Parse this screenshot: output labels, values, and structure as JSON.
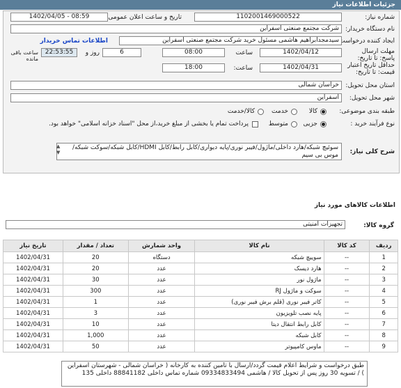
{
  "page_title": "جزئیات اطلاعات نیاز",
  "form": {
    "need_number_label": "شماره نیاز:",
    "need_number": "1102001469000522",
    "announce_label": "تاریخ و ساعت اعلان عمومی:",
    "announce_value": "1402/04/05 - 08:59",
    "buyer_label": "نام دستگاه خریدار:",
    "buyer_value": "شرکت مجتمع صنعتی اسفراین",
    "creator_label": "ایجاد کننده درخواست:",
    "creator_value": "سیدمجدابراهیم هاشمی مسئول خرید شرکت مجتمع صنعتی اسفراین",
    "contact_link": "اطلاعات تماس خریدار",
    "deadline_label": "مهلت ارسال پاسخ: تا تاریخ:",
    "deadline_date": "1402/04/12",
    "time_label": "ساعت",
    "deadline_time": "08:00",
    "days_value": "6",
    "days_label": "روز و",
    "remaining_time": "22:53:55",
    "remaining_label": "ساعت باقی مانده",
    "validity_label": "حداقل تاریخ اعتبار قیمت: تا تاریخ:",
    "validity_date": "1402/04/31",
    "validity_time_label": "ساعت:",
    "validity_time": "18:00",
    "province_label": "استان محل تحویل:",
    "province_value": "خراسان شمالی",
    "city_label": "شهر محل تحویل:",
    "city_value": "اسفراین",
    "category_label": "طبقه بندی موضوعی:",
    "category_options": [
      "کالا",
      "خدمت",
      "کالا/خدمت"
    ],
    "category_selected": 0,
    "process_label": "نوع فرآیند خرید :",
    "process_options": [
      "جزیی",
      "متوسط"
    ],
    "process_selected": 0,
    "payment_note": "پرداخت تمام یا بخشی از مبلغ خرید،از محل \"اسناد خزانه اسلامی\" خواهد بود."
  },
  "summary": {
    "label": "شرح کلی نیاز:",
    "text": "سوئیچ شبکه/هارد داخلی/ماژول/فیبر نوری/پایه دیواری/کابل رابط/کابل HDMI/کابل شبکه/سوکت شبکه/موس بی سیم"
  },
  "goods_section": "اطلاعات کالاهای مورد نیاز",
  "group_label": "گروه کالا:",
  "group_value": "تجهیزات امنیتی",
  "table": {
    "headers": [
      "ردیف",
      "کد کالا",
      "نام کالا",
      "واحد شمارش",
      "تعداد / مقدار",
      "تاریخ نیاز"
    ],
    "rows": [
      [
        "1",
        "--",
        "سوییچ شبکه",
        "دستگاه",
        "20",
        "1402/04/31"
      ],
      [
        "2",
        "--",
        "هارد دیسک",
        "عدد",
        "20",
        "1402/04/31"
      ],
      [
        "3",
        "--",
        "ماژول نور",
        "عدد",
        "30",
        "1402/04/31"
      ],
      [
        "4",
        "--",
        "سوکت و ماژول RJ",
        "عدد",
        "300",
        "1402/04/31"
      ],
      [
        "5",
        "--",
        "کاتر فیبر نوری (قلم برش فیبر نوری)",
        "عدد",
        "1",
        "1402/04/31"
      ],
      [
        "6",
        "--",
        "پایه نصب تلویزیون",
        "عدد",
        "3",
        "1402/04/31"
      ],
      [
        "7",
        "--",
        "کابل رابط انتقال دیتا",
        "عدد",
        "10",
        "1402/04/31"
      ],
      [
        "8",
        "--",
        "کابل شبکه",
        "عدد",
        "1,000",
        "1402/04/31"
      ],
      [
        "9",
        "--",
        "ماوس کامپیوتر",
        "عدد",
        "50",
        "1402/04/31"
      ]
    ]
  },
  "note": "طبق درخواست و شرایط اعلام قیمت گردد/ارسال با تامین کننده به کارخانه ( خراسان شمالی - شهرستان اسفراین ) / تسویه 30 روز پس از تحویل کالا / هاشمی 09334833494 شماره تماس داخلی 88841182 داخلی 135"
}
